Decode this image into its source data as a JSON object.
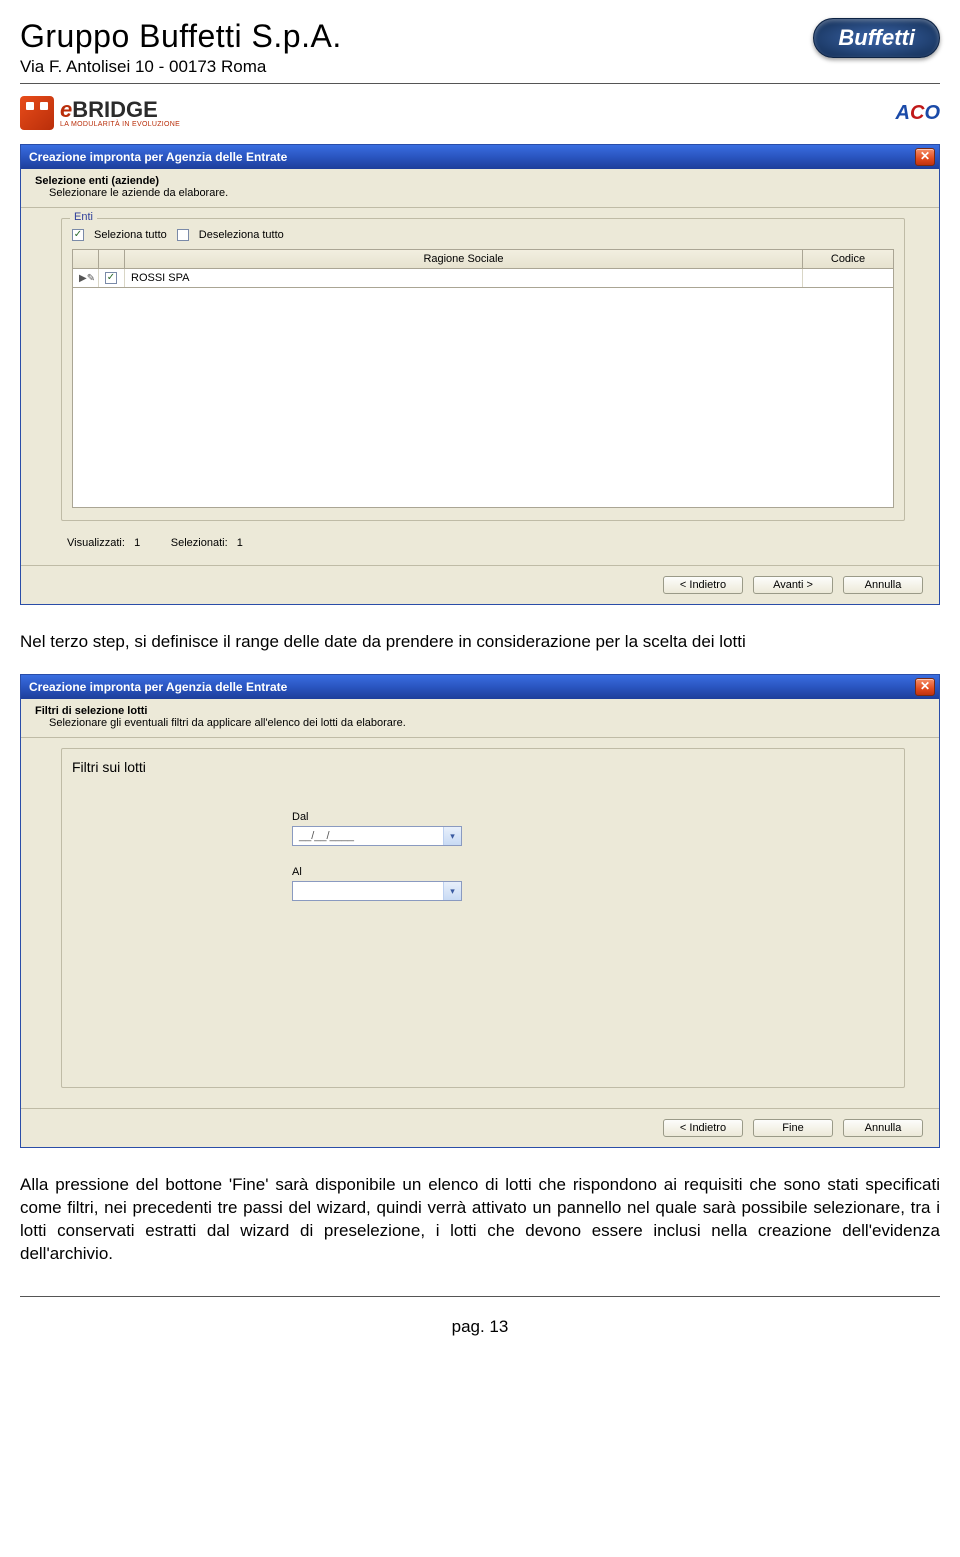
{
  "header": {
    "company": "Gruppo Buffetti S.p.A.",
    "address": "Via F. Antolisei 10 - 00173 Roma",
    "brand_pill": "Buffetti"
  },
  "logos": {
    "ebridge_prefix": "e",
    "ebridge_main": "BRIDGE",
    "ebridge_sub": "LA MODULARITÀ IN EVOLUZIONE",
    "aco": "ACO"
  },
  "dialog1": {
    "title": "Creazione impronta per Agenzia delle Entrate",
    "heading": "Selezione enti (aziende)",
    "sub": "Selezionare le aziende da elaborare.",
    "legend": "Enti",
    "select_all": "Seleziona tutto",
    "deselect_all": "Deseleziona tutto",
    "col_check": "",
    "col_ragione": "Ragione Sociale",
    "col_codice": "Codice",
    "row0_selected": "✓",
    "row0_ragione": "ROSSI SPA",
    "row0_codice": "",
    "visualizzati_label": "Visualizzati:",
    "visualizzati_val": "1",
    "selezionati_label": "Selezionati:",
    "selezionati_val": "1",
    "btn_back": "< Indietro",
    "btn_next": "Avanti >",
    "btn_cancel": "Annulla"
  },
  "para1": "Nel terzo step, si definisce il range delle date da prendere in considerazione per la scelta dei lotti",
  "dialog2": {
    "title": "Creazione impronta per Agenzia delle Entrate",
    "heading": "Filtri di selezione lotti",
    "sub": "Selezionare gli eventuali filtri da applicare all'elenco dei lotti da elaborare.",
    "legend": "Filtri sui lotti",
    "dal_label": "Dal",
    "dal_value": "__/__/____",
    "al_label": "Al",
    "al_value": "",
    "btn_back": "< Indietro",
    "btn_finish": "Fine",
    "btn_cancel": "Annulla"
  },
  "para2": "Alla pressione del bottone 'Fine' sarà disponibile un elenco di lotti che rispondono ai requisiti che sono stati specificati come filtri, nei precedenti tre passi del wizard, quindi verrà attivato un pannello nel quale sarà possibile selezionare, tra i lotti conservati estratti dal wizard di preselezione, i lotti che devono essere inclusi nella creazione dell'evidenza dell'archivio.",
  "footer": {
    "page": "pag. 13"
  }
}
